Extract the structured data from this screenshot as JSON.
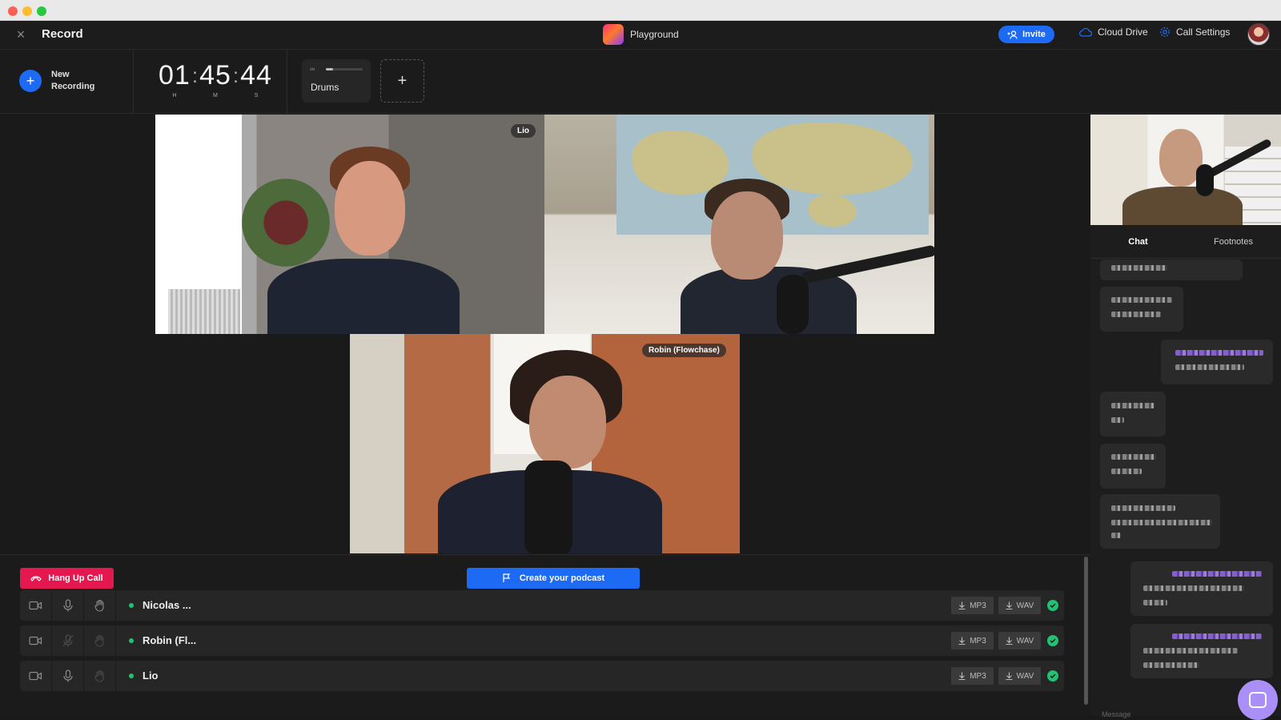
{
  "header": {
    "title": "Record",
    "workspace": "Playground",
    "invite_label": "Invite",
    "cloud_drive_label": "Cloud Drive",
    "call_settings_label": "Call Settings"
  },
  "recording": {
    "new_recording_label": "New Recording",
    "timer": {
      "hours": "01",
      "minutes": "45",
      "seconds": "44",
      "h_label": "H",
      "m_label": "M",
      "s_label": "S"
    },
    "track": {
      "name": "Drums",
      "level": 0.2
    },
    "add_track_label": "+"
  },
  "videos": [
    {
      "name": "Lio"
    },
    {
      "name": ""
    },
    {
      "name": "Robin (Flowchase)"
    }
  ],
  "side_panel": {
    "tabs": [
      "Chat",
      "Footnotes"
    ],
    "active_tab": "Chat",
    "message_placeholder": "Message"
  },
  "controls": {
    "hang_up_label": "Hang Up Call",
    "create_podcast_label": "Create your podcast"
  },
  "participants": [
    {
      "name": "Nicolas ...",
      "mp3_label": "MP3",
      "wav_label": "WAV",
      "mic_muted": false,
      "hand_dim": false
    },
    {
      "name": "Robin (Fl...",
      "mp3_label": "MP3",
      "wav_label": "WAV",
      "mic_muted": true,
      "hand_dim": true
    },
    {
      "name": "Lio",
      "mp3_label": "MP3",
      "wav_label": "WAV",
      "mic_muted": false,
      "hand_dim": true
    }
  ],
  "colors": {
    "accent_blue": "#1d6af5",
    "hangup_red": "#e4174f",
    "status_green": "#21c271",
    "chat_purple": "#9d6cf5"
  }
}
